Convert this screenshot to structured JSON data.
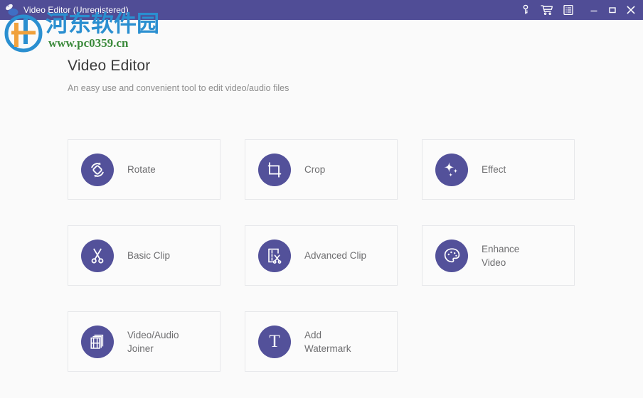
{
  "window": {
    "title": "Video Editor (Unregistered)",
    "titlebar_color": "#504d96",
    "app_icon": "video-editor-app-icon",
    "controls": [
      {
        "name": "key-icon",
        "label": "Register"
      },
      {
        "name": "cart-icon",
        "label": "Buy"
      },
      {
        "name": "menu-list-icon",
        "label": "Menu"
      }
    ],
    "window_buttons": [
      {
        "name": "minimize-button",
        "label": "Minimize"
      },
      {
        "name": "maximize-button",
        "label": "Maximize"
      },
      {
        "name": "close-button",
        "label": "Close"
      }
    ]
  },
  "watermark": {
    "chinese": "河东软件园",
    "url": "www.pc0359.cn",
    "chinese_color": "#2a8fd0",
    "url_color": "#3b8a3b"
  },
  "header": {
    "title": "Video Editor",
    "subtitle": "An easy use and convenient tool to edit video/audio files"
  },
  "theme": {
    "accent": "#53519a",
    "page_background": "#fafafa",
    "card_background": "#fbfbfb",
    "card_border": "#e6e7ea",
    "label_color": "#6e6e70"
  },
  "tools": [
    {
      "label": "Rotate",
      "icon": "rotate-icon"
    },
    {
      "label": "Crop",
      "icon": "crop-icon"
    },
    {
      "label": "Effect",
      "icon": "sparkle-icon"
    },
    {
      "label": "Basic Clip",
      "icon": "scissors-icon"
    },
    {
      "label": "Advanced Clip",
      "icon": "document-scissors-icon"
    },
    {
      "label": "Enhance\nVideo",
      "icon": "palette-icon"
    },
    {
      "label": "Video/Audio\nJoiner",
      "icon": "stacked-frames-icon"
    },
    {
      "label": "Add\nWatermark",
      "icon": "text-t-icon"
    }
  ]
}
